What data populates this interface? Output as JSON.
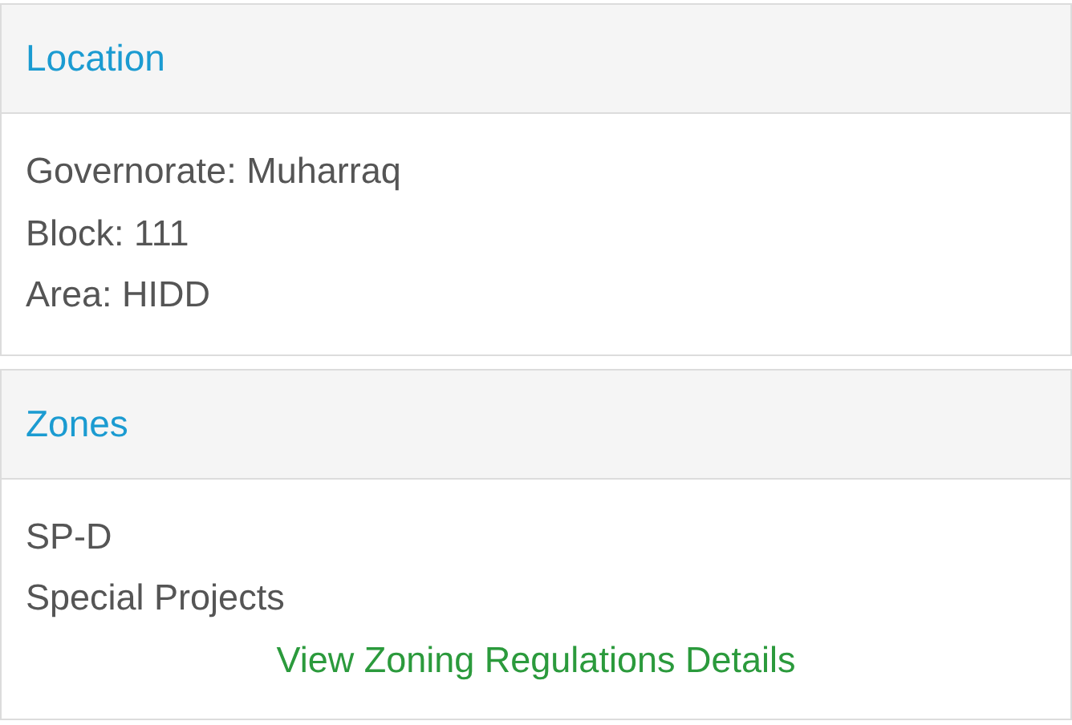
{
  "panels": [
    {
      "title": "Location",
      "lines": [
        "Governorate: Muharraq",
        "Block: 111",
        "Area: HIDD"
      ]
    },
    {
      "title": "Zones",
      "lines": [
        "SP-D",
        "Special Projects"
      ],
      "link": "View Zoning Regulations Details"
    }
  ]
}
